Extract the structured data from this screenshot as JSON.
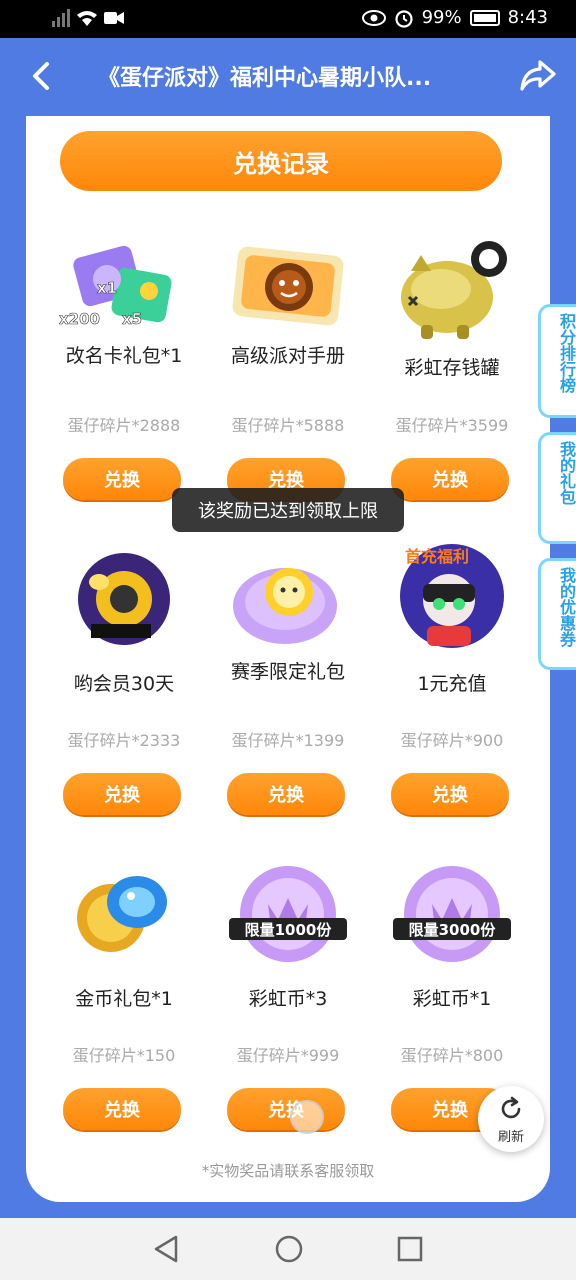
{
  "status_bar": {
    "battery": "99%",
    "time": "8:43",
    "icons": [
      "signal-icon",
      "wifi-icon",
      "video-icon",
      "eye-icon",
      "alarm-icon",
      "battery-icon"
    ]
  },
  "header": {
    "title": "《蛋仔派对》福利中心暑期小队...",
    "back_icon": "back-icon",
    "share_icon": "share-icon"
  },
  "record_button": "兑换记录",
  "rewards": [
    {
      "name": "改名卡礼包*1",
      "cost": "蛋仔碎片*2888",
      "button": "兑换",
      "art_texts": [
        "x1",
        "x200",
        "x5"
      ]
    },
    {
      "name": "高级派对手册",
      "cost": "蛋仔碎片*5888",
      "button": "兑换"
    },
    {
      "name": "彩虹存钱罐",
      "cost": "蛋仔碎片*3599",
      "button": "兑换"
    },
    {
      "name": "哟会员30天",
      "cost": "蛋仔碎片*2333",
      "button": "兑换"
    },
    {
      "name": "赛季限定礼包",
      "cost": "蛋仔碎片*1399",
      "button": "兑换"
    },
    {
      "name": "1元充值",
      "cost": "蛋仔碎片*900",
      "button": "兑换",
      "art_texts": [
        "首充福利"
      ]
    },
    {
      "name": "金币礼包*1",
      "cost": "蛋仔碎片*150",
      "button": "兑换"
    },
    {
      "name": "彩虹币*3",
      "cost": "蛋仔碎片*999",
      "button": "兑换",
      "art_texts": [
        "限量1000份"
      ]
    },
    {
      "name": "彩虹币*1",
      "cost": "蛋仔碎片*800",
      "button": "兑换",
      "art_texts": [
        "限量3000份"
      ]
    }
  ],
  "footer_note": "*实物奖品请联系客服领取",
  "side_tabs": [
    "积分排行榜",
    "我的礼包",
    "我的优惠券"
  ],
  "toast": "该奖励已达到领取上限",
  "refresh_label": "刷新",
  "nav_icons": [
    "back-triangle-icon",
    "home-circle-icon",
    "recents-square-icon"
  ],
  "colors": {
    "brand_blue": "#4f7be3",
    "orange": "#ff8709",
    "side_tab_text": "#2aa0e6"
  }
}
